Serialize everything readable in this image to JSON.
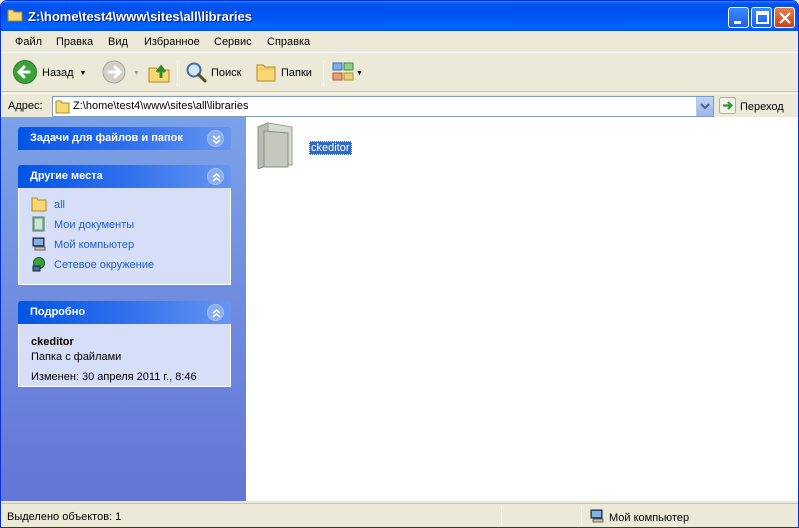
{
  "window": {
    "title": "Z:\\home\\test4\\www\\sites\\all\\libraries"
  },
  "menu": [
    "Файл",
    "Правка",
    "Вид",
    "Избранное",
    "Сервис",
    "Справка"
  ],
  "toolbar": {
    "back_label": "Назад",
    "search_label": "Поиск",
    "folders_label": "Папки"
  },
  "address": {
    "label": "Адрес:",
    "value": "Z:\\home\\test4\\www\\sites\\all\\libraries",
    "go_label": "Переход"
  },
  "sidebar": {
    "tasks_title": "Задачи для файлов и папок",
    "places_title": "Другие места",
    "places": [
      {
        "label": "all",
        "icon": "folder-icon"
      },
      {
        "label": "Мои документы",
        "icon": "my-documents-icon"
      },
      {
        "label": "Мой компьютер",
        "icon": "my-computer-icon"
      },
      {
        "label": "Сетевое окружение",
        "icon": "network-icon"
      }
    ],
    "details_title": "Подробно",
    "details": {
      "name": "ckeditor",
      "type": "Папка с файлами",
      "modified": "Изменен: 30 апреля 2011 г., 8:46"
    }
  },
  "files": [
    {
      "name": "ckeditor",
      "icon": "folder-icon",
      "selected": true
    }
  ],
  "status": {
    "selected_text": "Выделено объектов: 1",
    "location_label": "Мой компьютер"
  },
  "colors": {
    "titlebar": "#0053ee",
    "sidebar": "#7ba2e7",
    "link": "#215dc6",
    "selection": "#316ac5"
  }
}
